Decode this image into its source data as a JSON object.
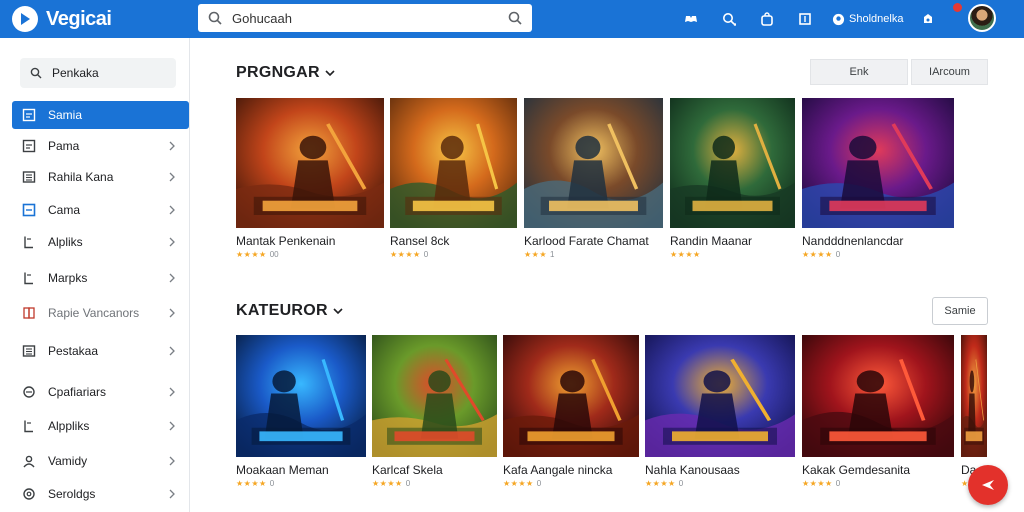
{
  "app": {
    "name": "Vegicai"
  },
  "search": {
    "value": "Gohucaah"
  },
  "topbar": {
    "account_label": "Sholdnelka"
  },
  "sidebar": {
    "search_label": "Penkaka",
    "items": [
      {
        "label": "Samia",
        "icon": "list-icon",
        "active": true,
        "chevron": false
      },
      {
        "label": "Pama",
        "icon": "list-icon",
        "active": false,
        "chevron": true
      },
      {
        "label": "Rahila Kana",
        "icon": "grid-icon",
        "active": false,
        "chevron": true
      },
      {
        "label": "Cama",
        "icon": "checkbox-icon",
        "active": false,
        "chevron": true
      },
      {
        "label": "Alpliks",
        "icon": "tag-icon",
        "active": false,
        "chevron": true
      },
      {
        "label": "Marpks",
        "icon": "tag-icon",
        "active": false,
        "chevron": true
      },
      {
        "label": "Rapie Vancanors",
        "icon": "book-icon",
        "active": false,
        "chevron": true,
        "muted": true
      },
      {
        "label": "Pestakaa",
        "icon": "grid-icon",
        "active": false,
        "chevron": true
      },
      {
        "label": "Cpafiariars",
        "icon": "circle-icon",
        "active": false,
        "chevron": true
      },
      {
        "label": "Alppliks",
        "icon": "tag-icon",
        "active": false,
        "chevron": true
      },
      {
        "label": "Vamidy",
        "icon": "user-icon",
        "active": false,
        "chevron": true
      },
      {
        "label": "Seroldgs",
        "icon": "settings-icon",
        "active": false,
        "chevron": true
      }
    ]
  },
  "section1": {
    "title": "PRGNGAR",
    "buttons": [
      "Enk",
      "IArcoum"
    ],
    "cards": [
      {
        "title": "Mantak Penkenain",
        "rating": "★★★★",
        "count": "00"
      },
      {
        "title": "Ransel 8ck",
        "rating": "★★★★",
        "count": "0"
      },
      {
        "title": "Karlood Farate Chamat",
        "rating": "★★★",
        "count": "1"
      },
      {
        "title": "Randin Maanar",
        "rating": "★★★★",
        "count": ""
      },
      {
        "title": "Nandddnenlancdar",
        "rating": "★★★★",
        "count": "0"
      }
    ]
  },
  "section2": {
    "title": "KATEUROR",
    "button": "Samie",
    "cards": [
      {
        "title": "Moakaan Meman",
        "rating": "★★★★",
        "count": "0"
      },
      {
        "title": "Karlcaf Skela",
        "rating": "★★★★",
        "count": "0"
      },
      {
        "title": "Kafa Aangale nincka",
        "rating": "★★★★",
        "count": "0"
      },
      {
        "title": "Nahla Kanousaas",
        "rating": "★★★★",
        "count": "0"
      },
      {
        "title": "Kakak Gemdesanita",
        "rating": "★★★★",
        "count": "0"
      },
      {
        "title": "Da",
        "rating": "★",
        "count": ""
      }
    ]
  },
  "colors": {
    "primary": "#1a73d6",
    "fab": "#e3312b",
    "star": "#f5a623"
  }
}
